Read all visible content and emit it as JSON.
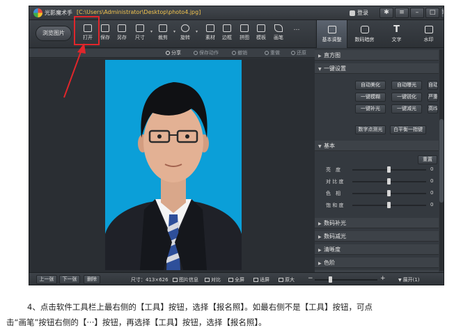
{
  "window": {
    "app_name": "光影魔术手",
    "file_path": "[C:\\Users\\Administrator\\Desktop\\photo4.jpg]",
    "login_label": "登录"
  },
  "toolbar": {
    "browse_label": "浏览图片",
    "tools": [
      {
        "label": "打开",
        "icon": "open-icon"
      },
      {
        "label": "保存",
        "icon": "save-icon"
      },
      {
        "label": "另存",
        "icon": "save-as-icon"
      },
      {
        "label": "尺寸",
        "icon": "resize-icon"
      },
      {
        "label": "裁剪",
        "icon": "crop-icon"
      },
      {
        "label": "旋转",
        "icon": "rotate-icon"
      },
      {
        "label": "素材",
        "icon": "material-icon"
      },
      {
        "label": "边框",
        "icon": "frame-icon"
      },
      {
        "label": "拼图",
        "icon": "collage-icon"
      },
      {
        "label": "模板",
        "icon": "template-icon"
      },
      {
        "label": "画笔",
        "icon": "brush-icon"
      },
      {
        "label": "…",
        "icon": "more-icon"
      }
    ]
  },
  "tabs": [
    {
      "label": "基本调整",
      "icon": "adjust-icon"
    },
    {
      "label": "数码暗房",
      "icon": "camera-icon"
    },
    {
      "label": "文字",
      "icon": "text-icon"
    },
    {
      "label": "水印",
      "icon": "watermark-icon"
    }
  ],
  "subbar": {
    "share": "分享",
    "save_action": "保存动作",
    "undo": "撤销",
    "redo": "重做",
    "restore": "还原"
  },
  "panel": {
    "histogram": "直方图",
    "one_click": "一键设置",
    "one_click_buttons": [
      "自动美化",
      "自动曝光",
      "自动白平衡",
      "一键模糊",
      "一键锐化",
      "严重白平衡",
      "一键补光",
      "一键减光",
      "高ISO降噪"
    ],
    "extra_buttons": [
      "数字点测光",
      "白平衡一指键"
    ],
    "basic": "基本",
    "reset": "重置",
    "sliders": [
      {
        "label": "亮　度",
        "value": "0"
      },
      {
        "label": "对 比 度",
        "value": "0"
      },
      {
        "label": "色　相",
        "value": "0"
      },
      {
        "label": "饱 和 度",
        "value": "0"
      }
    ],
    "sections": [
      "数码补光",
      "数码减光",
      "清晰度",
      "色阶",
      "曲线"
    ]
  },
  "statusbar": {
    "prev": "上一张",
    "next": "下一张",
    "delete": "删除",
    "size": "尺寸：413×626",
    "info": "图片信息",
    "compare": "对比",
    "fullscreen": "全屏",
    "fit": "适屏",
    "original": "原大",
    "expand": "展开(1)"
  },
  "caption": {
    "line1": "4、点击软件工具栏上最右侧的【工具】按钮，选择【报名照】。如最右侧不是【工具】按钮，可点",
    "line2": "击“画笔”按钮右侧的【···】按钮，再选择【工具】按钮，选择【报名照】。"
  },
  "colors": {
    "photo_background": "#0b9fd8",
    "annotation_red": "#e0262b",
    "path_text": "#f2c44e"
  }
}
